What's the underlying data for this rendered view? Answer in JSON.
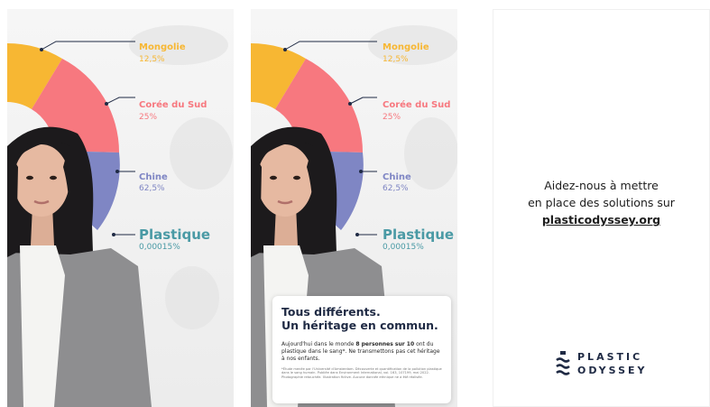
{
  "chart_data": {
    "type": "pie",
    "slices": [
      {
        "label": "Mongolie",
        "value_label": "12,5%",
        "value": 12.5,
        "color": "#f7b733"
      },
      {
        "label": "Corée du Sud",
        "value_label": "25%",
        "value": 25,
        "color": "#f7787f"
      },
      {
        "label": "Chine",
        "value_label": "62,5%",
        "value": 62.5,
        "color": "#7f86c4"
      },
      {
        "label": "Plastique",
        "value_label": "0,00015%",
        "value": 0.00015,
        "color": "#4a9aa5"
      }
    ]
  },
  "card": {
    "headline_line1": "Tous différents.",
    "headline_line2": "Un héritage en commun.",
    "body_part1": "Aujourd'hui dans le monde ",
    "body_bold": "8 personnes sur 10",
    "body_part2": " ont du plastique dans le sang*. Ne transmettons pas cet héritage à nos enfants.",
    "footnote": "*Étude menée par l'Université d'Amsterdam. Découverte et quantification de la pollution plastique dans le sang humain. Publiée dans Environment International, vol. 163, 107199, mai 2022. Photographie retouchée. Illustration fictive. Aucune donnée ethnique ne a été réalisée."
  },
  "cta": {
    "line1": "Aidez-nous à mettre",
    "line2": "en place des solutions sur",
    "url": "plasticodyssey.org"
  },
  "brand": {
    "line1": "PLASTIC",
    "line2": "ODYSSEY"
  },
  "colors": {
    "accent_dark": "#1f2a44",
    "jacket": "#8e8e90"
  }
}
